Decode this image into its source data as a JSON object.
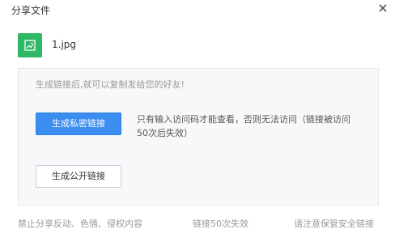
{
  "dialog": {
    "title": "分享文件",
    "close_icon": "close-icon"
  },
  "file": {
    "icon": "image-file-icon",
    "icon_color": "#2fb866",
    "name": "1.jpg"
  },
  "panel": {
    "hint": "生成链接后,就可以复制发给您的好友!",
    "private_button_label": "生成私密链接",
    "private_description": "只有输入访问码才能查看，否则无法访问（链接被访问50次后失效）",
    "public_button_label": "生成公开链接",
    "accent_color": "#3b8df0"
  },
  "footer": {
    "notes": [
      "禁止分享反动、色情、侵权内容",
      "链接50次失效",
      "请注意保管安全链接"
    ]
  }
}
